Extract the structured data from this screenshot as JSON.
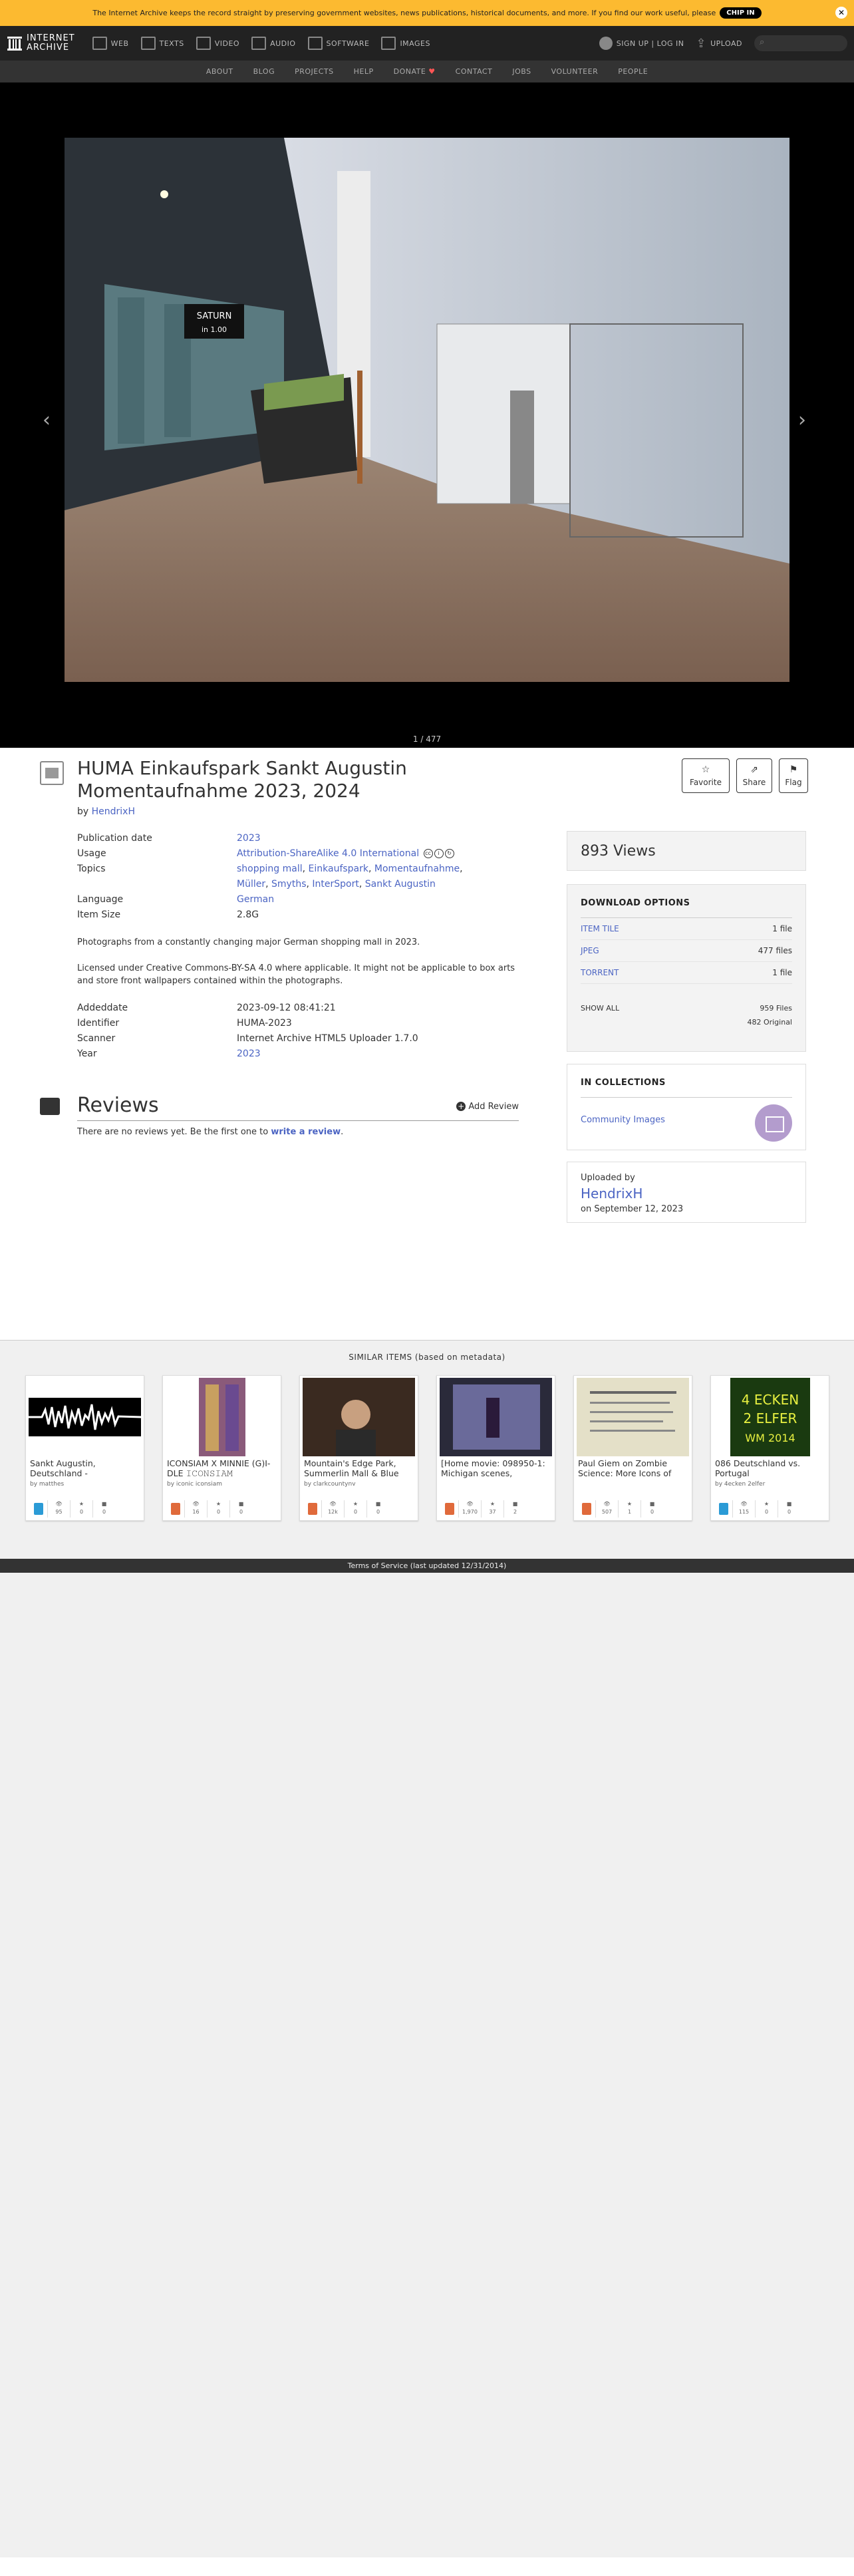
{
  "banner": {
    "text": "The Internet Archive keeps the record straight by preserving government websites, news publications, historical documents, and more. If you find our work useful, please",
    "button": "CHIP IN"
  },
  "topnav": {
    "logo_line1": "INTERNET",
    "logo_line2": "ARCHIVE",
    "items": [
      "WEB",
      "TEXTS",
      "VIDEO",
      "AUDIO",
      "SOFTWARE",
      "IMAGES"
    ],
    "signin": "SIGN UP | LOG IN",
    "upload": "UPLOAD"
  },
  "subnav": [
    "ABOUT",
    "BLOG",
    "PROJECTS",
    "HELP",
    "DONATE",
    "CONTACT",
    "JOBS",
    "VOLUNTEER",
    "PEOPLE"
  ],
  "viewer": {
    "page_count": "1 / 477",
    "prev": "‹",
    "next": "›"
  },
  "item": {
    "title": "HUMA Einkaufspark Sankt Augustin Momentaufnahme 2023, 2024",
    "by_prefix": "by",
    "author": "HendrixH",
    "actions": {
      "favorite": "Favorite",
      "share": "Share",
      "flag": "Flag"
    },
    "meta": {
      "pubdate_label": "Publication date",
      "pubdate": "2023",
      "usage_label": "Usage",
      "usage": "Attribution-ShareAlike 4.0 International",
      "topics_label": "Topics",
      "topics": [
        "shopping mall",
        "Einkaufspark",
        "Momentaufnahme",
        "Müller",
        "Smyths",
        "InterSport",
        "Sankt Augustin"
      ],
      "language_label": "Language",
      "language": "German",
      "size_label": "Item Size",
      "size": "2.8G"
    },
    "description": [
      "Photographs from a constantly changing major German shopping mall in 2023.",
      "Licensed under Creative Commons-BY-SA 4.0 where applicable. It might not be applicable to box arts and store front wallpapers contained within the photographs."
    ],
    "meta2": {
      "addeddate_label": "Addeddate",
      "addeddate": "2023-09-12 08:41:21",
      "identifier_label": "Identifier",
      "identifier": "HUMA-2023",
      "scanner_label": "Scanner",
      "scanner": "Internet Archive HTML5 Uploader 1.7.0",
      "year_label": "Year",
      "year": "2023"
    }
  },
  "reviews": {
    "heading": "Reviews",
    "add": "Add Review",
    "none_text": "There are no reviews yet. Be the first one to",
    "none_link": "write a review",
    "period": "."
  },
  "sidebar": {
    "views": "893 Views",
    "download": {
      "heading": "DOWNLOAD OPTIONS",
      "rows": [
        {
          "label": "ITEM TILE",
          "count": "1 file"
        },
        {
          "label": "JPEG",
          "count": "477 files"
        },
        {
          "label": "TORRENT",
          "count": "1 file"
        }
      ],
      "show_all": "SHOW ALL",
      "total": "959 Files",
      "original": "482 Original"
    },
    "collections": {
      "heading": "IN COLLECTIONS",
      "name": "Community Images"
    },
    "uploader": {
      "label": "Uploaded by",
      "name": "HendrixH",
      "date": "on September 12, 2023"
    }
  },
  "similar": {
    "heading": "SIMILAR ITEMS (based on metadata)",
    "tiles": [
      {
        "title": "Sankt Augustin, Deutschland -",
        "by": "by matthes",
        "views": "95",
        "favs": "0",
        "reviews": "0",
        "type_color": "#2b9bd6"
      },
      {
        "title": "ICONSIAM X MINNIE (G)I-DLE 𝙸𝙲𝙾𝙽𝚂𝙸𝙰𝙼",
        "by": "by iconic iconsiam",
        "views": "16",
        "favs": "0",
        "reviews": "0",
        "type_color": "#e06a3b"
      },
      {
        "title": "Mountain's Edge Park, Summerlin Mall & Blue",
        "by": "by clarkcountynv",
        "views": "12k",
        "favs": "0",
        "reviews": "0",
        "type_color": "#e06a3b"
      },
      {
        "title": "[Home movie: 098950-1: Michigan scenes,",
        "by": "",
        "views": "1,970",
        "favs": "37",
        "reviews": "2",
        "type_color": "#e06a3b"
      },
      {
        "title": "Paul Giem on Zombie Science: More Icons of",
        "by": "",
        "views": "507",
        "favs": "1",
        "reviews": "0",
        "type_color": "#e06a3b"
      },
      {
        "title": "086 Deutschland vs. Portugal",
        "by": "by 4ecken 2elfer",
        "views": "115",
        "favs": "0",
        "reviews": "0",
        "type_color": "#2b9bd6"
      }
    ]
  },
  "footer": "Terms of Service (last updated 12/31/2014)",
  "photo_signs": {
    "saturn": "SATURN",
    "saturn_floor": "in 1.00"
  }
}
